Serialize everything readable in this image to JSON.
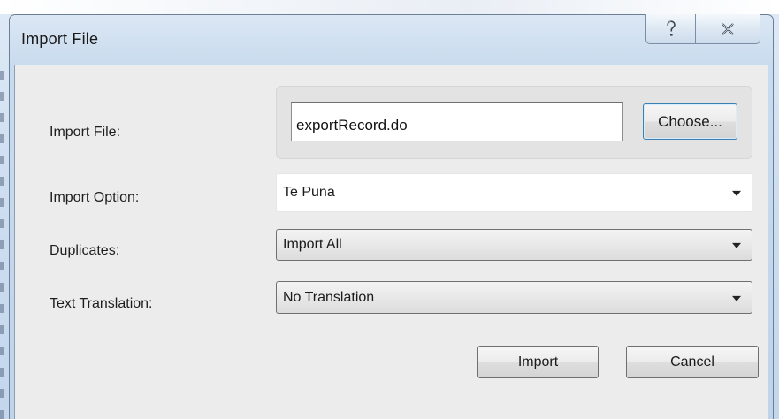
{
  "window": {
    "title": "Import File"
  },
  "caption": {
    "help_icon": "question-mark-icon",
    "close_icon": "close-x-icon"
  },
  "form": {
    "import_file_label": "Import File:",
    "import_file_value": "exportRecord.do",
    "choose_label": "Choose...",
    "import_option_label": "Import Option:",
    "import_option_value": "Te Puna",
    "duplicates_label": "Duplicates:",
    "duplicates_value": "Import All",
    "text_translation_label": "Text Translation:",
    "text_translation_value": "No Translation"
  },
  "buttons": {
    "import_label": "Import",
    "cancel_label": "Cancel"
  }
}
